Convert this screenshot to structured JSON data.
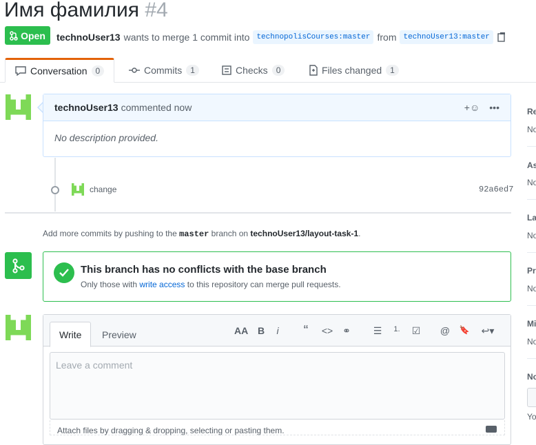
{
  "pr": {
    "title": "Имя фамилия",
    "number": "#4",
    "state": "Open",
    "author": "technoUser13",
    "merge_text": "wants to merge 1 commit into",
    "base_branch": "technopolisCourses:master",
    "from_text": "from",
    "head_branch": "technoUser13:master"
  },
  "tabs": [
    {
      "label": "Conversation",
      "count": "0"
    },
    {
      "label": "Commits",
      "count": "1"
    },
    {
      "label": "Checks",
      "count": "0"
    },
    {
      "label": "Files changed",
      "count": "1"
    }
  ],
  "comment": {
    "author": "technoUser13",
    "action": "commented now",
    "body": "No description provided."
  },
  "commit": {
    "message": "change",
    "sha": "92a6ed7"
  },
  "push_note": {
    "prefix": "Add more commits by pushing to the",
    "branch": "master",
    "middle": "branch on",
    "repo": "technoUser13/layout-task-1",
    "suffix": "."
  },
  "merge": {
    "title": "This branch has no conflicts with the base branch",
    "sub_prefix": "Only those with",
    "sub_link": "write access",
    "sub_suffix": "to this repository can merge pull requests."
  },
  "editor": {
    "write_tab": "Write",
    "preview_tab": "Preview",
    "placeholder": "Leave a comment",
    "attach_text": "Attach files by dragging & dropping, selecting or pasting them.",
    "tools": [
      "AA",
      "B",
      "i",
      "“",
      "<>",
      "⚭",
      "☰",
      "1.",
      "☑",
      "@",
      "🔖",
      "↩▾"
    ]
  },
  "sidebar": {
    "labels": [
      "Re",
      "As",
      "La",
      "Pr",
      "Mi",
      "No"
    ],
    "values": [
      "No",
      "No",
      "No",
      "No",
      "No"
    ],
    "footer": "You"
  },
  "colors": {
    "success": "#2cbe4e",
    "link": "#0366d6",
    "accent_tab": "#e36209"
  }
}
